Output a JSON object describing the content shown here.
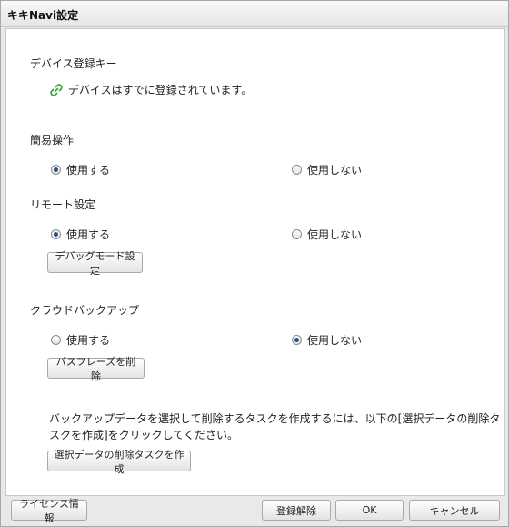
{
  "window": {
    "title": "キキNavi設定"
  },
  "device_key": {
    "heading": "デバイス登録キー",
    "status": "デバイスはすでに登録されています。"
  },
  "simple_operation": {
    "heading": "簡易操作",
    "option_use": "使用する",
    "option_not_use": "使用しない",
    "selected": "use"
  },
  "remote_settings": {
    "heading": "リモート設定",
    "option_use": "使用する",
    "option_not_use": "使用しない",
    "selected": "use",
    "debug_button": "デバッグモード設定"
  },
  "cloud_backup": {
    "heading": "クラウドバックアップ",
    "option_use": "使用する",
    "option_not_use": "使用しない",
    "selected": "not_use",
    "delete_passphrase_button": "パスフレーズを削除",
    "note": "バックアップデータを選択して削除するタスクを作成するには、以下の[選択データの削除タスクを作成]をクリックしてください。",
    "create_task_button": "選択データの削除タスクを作成"
  },
  "footer": {
    "license_button": "ライセンス情報",
    "unregister_button": "登録解除",
    "ok_button": "OK",
    "cancel_button": "キャンセル"
  }
}
